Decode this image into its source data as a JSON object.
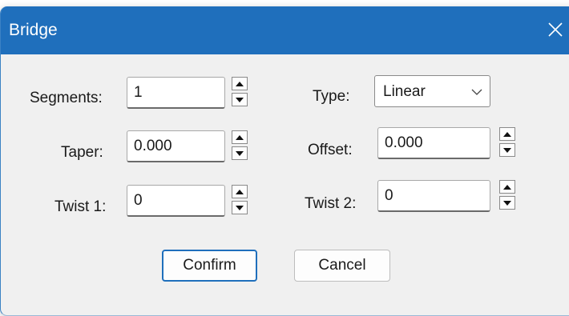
{
  "window": {
    "title": "Bridge",
    "titlebar_color": "#1f6fbc"
  },
  "fields": {
    "segments": {
      "label": "Segments:",
      "value": "1"
    },
    "taper": {
      "label": "Taper:",
      "value": "0.000"
    },
    "twist1": {
      "label": "Twist 1:",
      "value": "0"
    },
    "offset": {
      "label": "Offset:",
      "value": "0.000"
    },
    "twist2": {
      "label": "Twist 2:",
      "value": "0"
    }
  },
  "type": {
    "label": "Type:",
    "selected": "Linear"
  },
  "buttons": {
    "confirm": "Confirm",
    "cancel": "Cancel"
  },
  "icons": {
    "close": "close-icon",
    "spin_up": "triangle-up-icon",
    "spin_down": "triangle-down-icon",
    "dropdown": "chevron-down-icon"
  }
}
